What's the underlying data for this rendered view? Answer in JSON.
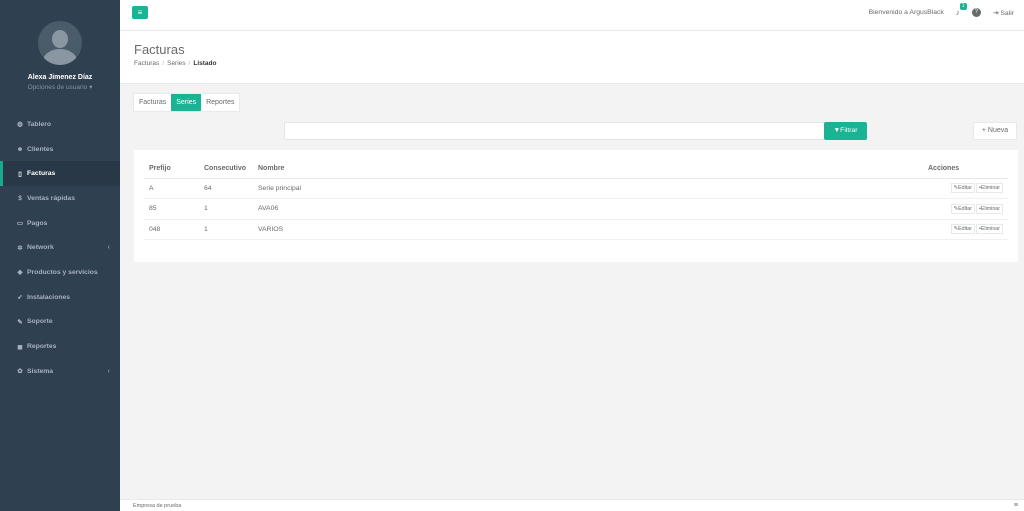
{
  "sidebar": {
    "user_name": "Alexa Jimenez Díaz",
    "user_options": "Opciones de usuario ▾",
    "items": [
      {
        "label": "Tablero",
        "icon": "dashboard-icon"
      },
      {
        "label": "Clientes",
        "icon": "users-icon"
      },
      {
        "label": "Facturas",
        "icon": "file-icon"
      },
      {
        "label": "Ventas rápidas",
        "icon": "dollar-icon"
      },
      {
        "label": "Pagos",
        "icon": "money-icon"
      },
      {
        "label": "Network",
        "icon": "network-icon"
      },
      {
        "label": "Productos y servicios",
        "icon": "tag-icon"
      },
      {
        "label": "Instalaciones",
        "icon": "rocket-icon"
      },
      {
        "label": "Soporte",
        "icon": "wrench-icon"
      },
      {
        "label": "Reportes",
        "icon": "report-icon"
      },
      {
        "label": "Sistema",
        "icon": "cogs-icon"
      }
    ]
  },
  "topbar": {
    "welcome": "Bienvenido a ArgusBlack",
    "notification_count": "1",
    "logout": "Salir"
  },
  "heading": {
    "title": "Facturas",
    "crumb1": "Facturas",
    "crumb2": "Series",
    "crumb3": "Listado"
  },
  "tabs": [
    "Facturas",
    "Series",
    "Reportes"
  ],
  "filter": {
    "button": "Filtrar",
    "new_button": "Nueva"
  },
  "table": {
    "headers": [
      "Prefijo",
      "Consecutivo",
      "Nombre",
      "Acciones"
    ],
    "rows": [
      {
        "prefijo": "A",
        "consecutivo": "64",
        "nombre": "Serie principal"
      },
      {
        "prefijo": "85",
        "consecutivo": "1",
        "nombre": "AVA06"
      },
      {
        "prefijo": "048",
        "consecutivo": "1",
        "nombre": "VARIOS"
      }
    ],
    "edit_label": "Editar",
    "delete_label": "Eliminar"
  },
  "footer": {
    "text": "Empresa de prueba"
  },
  "colors": {
    "accent": "#1ab394",
    "sidebar": "#2f4050"
  }
}
